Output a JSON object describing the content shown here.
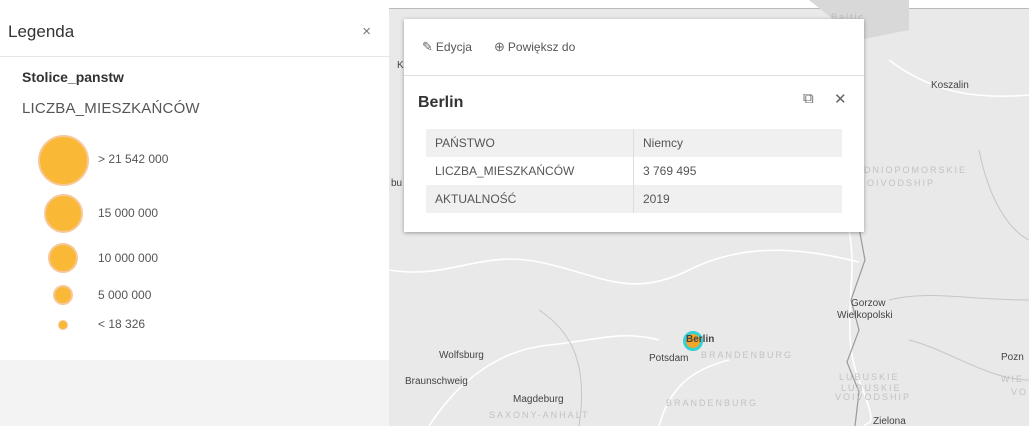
{
  "legend": {
    "title": "Legenda",
    "close": "×",
    "layer": "Stolice_panstw",
    "field": "LICZBA_MIESZKAŃCÓW",
    "classes": [
      {
        "label": "> 21 542 000"
      },
      {
        "label": "15 000 000"
      },
      {
        "label": "10 000 000"
      },
      {
        "label": "5 000 000"
      },
      {
        "label": "< 18 326"
      }
    ]
  },
  "popup": {
    "actions": [
      {
        "label": "Edycja",
        "icon": "edit-icon"
      },
      {
        "label": "Powiększ do",
        "icon": "zoom-in-icon"
      }
    ],
    "title": "Berlin",
    "fields": [
      {
        "key": "PAŃSTWO",
        "value": "Niemcy"
      },
      {
        "key": "LICZBA_MIESZKAŃCÓW",
        "value": "3 769 495"
      },
      {
        "key": "AKTUALNOŚĆ",
        "value": "2019"
      }
    ]
  },
  "map": {
    "places": {
      "koszalin": "Koszalin",
      "gorzow1": "Gorzow",
      "gorzow2": "Wielkopolski",
      "berlin": "Berlin",
      "potsdam": "Potsdam",
      "wolfsburg": "Wolfsburg",
      "braunschweig": "Braunschweig",
      "magdeburg": "Magdeburg",
      "zielona": "Zielona",
      "pozn": "Pozn",
      "ki": "Ki",
      "bu": "bu"
    },
    "regions": {
      "brandenburg": "BRANDENBURG",
      "brandenburg2": "BRANDENBURG",
      "saxony": "SAXONY-ANHALT",
      "lubuskie1": "LUBUSKIE",
      "lubuskie2": "LUBUSKIE",
      "lubuskie3": "VOIVODSHIP",
      "zpom1": "DNIOPOMORSKIE",
      "zpom2": "OIVODSHIP",
      "wie": "WIE",
      "vo": "VO",
      "baltic": "Baltic"
    },
    "colors": {
      "symbol": "#f9b836",
      "highlight": "#32d1d6"
    }
  }
}
